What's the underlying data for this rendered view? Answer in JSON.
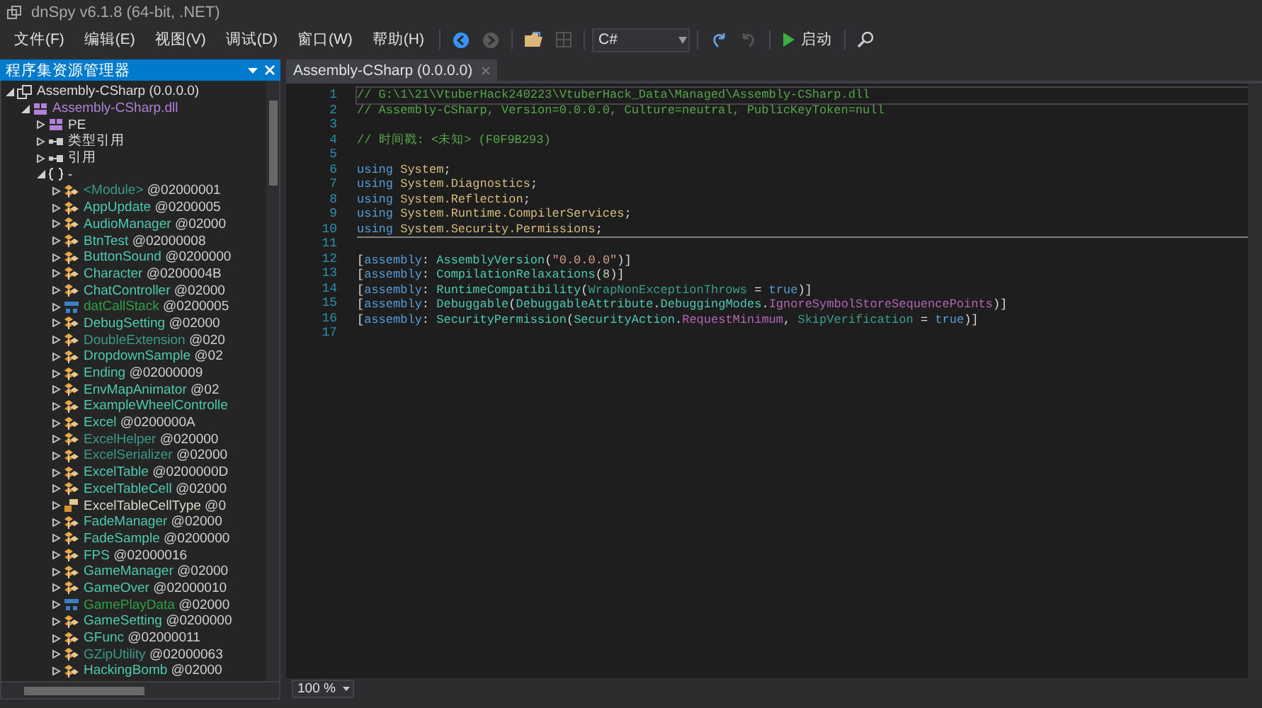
{
  "window": {
    "title": "dnSpy v6.1.8 (64-bit, .NET)"
  },
  "menu": [
    "文件(F)",
    "编辑(E)",
    "视图(V)",
    "调试(D)",
    "窗口(W)",
    "帮助(H)"
  ],
  "toolbar": {
    "language": "C#",
    "start_label": "启动",
    "back_disabled": false,
    "forward_disabled": true,
    "undo_disabled": false,
    "redo_disabled": true
  },
  "explorer": {
    "title": "程序集资源管理器",
    "tree": [
      {
        "label": "Assembly-CSharp (0.0.0.0)",
        "kind": "assembly",
        "expanded": true,
        "children": [
          {
            "label": "Assembly-CSharp.dll",
            "kind": "module",
            "expanded": true,
            "children": [
              {
                "label": "PE",
                "kind": "pe",
                "expanded": false
              },
              {
                "label": "类型引用",
                "kind": "refs",
                "expanded": false
              },
              {
                "label": "引用",
                "kind": "refs",
                "expanded": false
              },
              {
                "label": "-",
                "kind": "namespace",
                "expanded": true,
                "children": [
                  {
                    "label": "<Module>",
                    "token": "@02000001",
                    "kind": "static",
                    "expanded": false
                  },
                  {
                    "label": "AppUpdate",
                    "token": "@0200005",
                    "kind": "class",
                    "expanded": false
                  },
                  {
                    "label": "AudioManager",
                    "token": "@02000",
                    "kind": "class",
                    "expanded": false
                  },
                  {
                    "label": "BtnTest",
                    "token": "@02000008",
                    "kind": "class",
                    "expanded": false
                  },
                  {
                    "label": "ButtonSound",
                    "token": "@0200000",
                    "kind": "class",
                    "expanded": false
                  },
                  {
                    "label": "Character",
                    "token": "@0200004B",
                    "kind": "class",
                    "expanded": false
                  },
                  {
                    "label": "ChatController",
                    "token": "@02000",
                    "kind": "class",
                    "expanded": false
                  },
                  {
                    "label": "datCallStack",
                    "token": "@0200005",
                    "kind": "struct",
                    "expanded": false
                  },
                  {
                    "label": "DebugSetting",
                    "token": "@02000",
                    "kind": "class",
                    "expanded": false
                  },
                  {
                    "label": "DoubleExtension",
                    "token": "@020",
                    "kind": "static",
                    "expanded": false
                  },
                  {
                    "label": "DropdownSample",
                    "token": "@02",
                    "kind": "class",
                    "expanded": false
                  },
                  {
                    "label": "Ending",
                    "token": "@02000009",
                    "kind": "class",
                    "expanded": false
                  },
                  {
                    "label": "EnvMapAnimator",
                    "token": "@02",
                    "kind": "class",
                    "expanded": false
                  },
                  {
                    "label": "ExampleWheelControlle",
                    "kind": "class",
                    "expanded": false
                  },
                  {
                    "label": "Excel",
                    "token": "@0200000A",
                    "kind": "class",
                    "expanded": false
                  },
                  {
                    "label": "ExcelHelper",
                    "token": "@020000",
                    "kind": "static",
                    "expanded": false
                  },
                  {
                    "label": "ExcelSerializer",
                    "token": "@02000",
                    "kind": "static",
                    "expanded": false
                  },
                  {
                    "label": "ExcelTable",
                    "token": "@0200000D",
                    "kind": "class",
                    "expanded": false
                  },
                  {
                    "label": "ExcelTableCell",
                    "token": "@02000",
                    "kind": "class",
                    "expanded": false
                  },
                  {
                    "label": "ExcelTableCellType",
                    "token": "@0",
                    "kind": "enum",
                    "expanded": false
                  },
                  {
                    "label": "FadeManager",
                    "token": "@02000",
                    "kind": "class",
                    "expanded": false
                  },
                  {
                    "label": "FadeSample",
                    "token": "@0200000",
                    "kind": "class",
                    "expanded": false
                  },
                  {
                    "label": "FPS",
                    "token": "@02000016",
                    "kind": "class",
                    "expanded": false
                  },
                  {
                    "label": "GameManager",
                    "token": "@02000",
                    "kind": "class",
                    "expanded": false
                  },
                  {
                    "label": "GameOver",
                    "token": "@02000010",
                    "kind": "class",
                    "expanded": false
                  },
                  {
                    "label": "GamePlayData",
                    "token": "@02000",
                    "kind": "struct",
                    "expanded": false
                  },
                  {
                    "label": "GameSetting",
                    "token": "@0200000",
                    "kind": "class",
                    "expanded": false
                  },
                  {
                    "label": "GFunc",
                    "token": "@02000011",
                    "kind": "class",
                    "expanded": false
                  },
                  {
                    "label": "GZipUtility",
                    "token": "@02000063",
                    "kind": "static",
                    "expanded": false
                  },
                  {
                    "label": "HackingBomb",
                    "token": "@02000",
                    "kind": "class",
                    "expanded": false
                  }
                ]
              }
            ]
          }
        ]
      }
    ]
  },
  "editor": {
    "tab": "Assembly-CSharp (0.0.0.0)",
    "zoom": "100 %",
    "lines": [
      {
        "number": "1",
        "current": true,
        "separator": false,
        "tokens": [
          {
            "kind": "comment",
            "text": "// G:\\1\\21\\VtuberHack240223\\VtuberHack_Data\\Managed\\Assembly-CSharp.dll"
          }
        ]
      },
      {
        "number": "2",
        "current": false,
        "separator": false,
        "tokens": [
          {
            "kind": "comment",
            "text": "// Assembly-CSharp, Version=0.0.0.0, Culture=neutral, PublicKeyToken=null"
          }
        ]
      },
      {
        "number": "3",
        "current": false,
        "separator": false
      },
      {
        "number": "4",
        "current": false,
        "separator": false,
        "tokens": [
          {
            "kind": "comment",
            "text": "// 时间戳: <未知> (F0F9B293)"
          }
        ]
      },
      {
        "number": "5",
        "current": false,
        "separator": false
      },
      {
        "number": "6",
        "current": false,
        "separator": false,
        "tokens": [
          {
            "kind": "keyword",
            "text": "using "
          },
          {
            "kind": "namespace",
            "text": "System"
          },
          {
            "kind": "plain",
            "text": ";"
          }
        ]
      },
      {
        "number": "7",
        "current": false,
        "separator": false,
        "tokens": [
          {
            "kind": "keyword",
            "text": "using "
          },
          {
            "kind": "namespace",
            "text": "System.Diagnostics"
          },
          {
            "kind": "plain",
            "text": ";"
          }
        ]
      },
      {
        "number": "8",
        "current": false,
        "separator": false,
        "tokens": [
          {
            "kind": "keyword",
            "text": "using "
          },
          {
            "kind": "namespace",
            "text": "System.Reflection"
          },
          {
            "kind": "plain",
            "text": ";"
          }
        ]
      },
      {
        "number": "9",
        "current": false,
        "separator": false,
        "tokens": [
          {
            "kind": "keyword",
            "text": "using "
          },
          {
            "kind": "namespace",
            "text": "System.Runtime.CompilerServices"
          },
          {
            "kind": "plain",
            "text": ";"
          }
        ]
      },
      {
        "number": "10",
        "current": false,
        "separator": true,
        "tokens": [
          {
            "kind": "keyword",
            "text": "using "
          },
          {
            "kind": "namespace",
            "text": "System.Security.Permissions"
          },
          {
            "kind": "plain",
            "text": ";"
          }
        ]
      },
      {
        "number": "11",
        "current": false,
        "separator": false
      },
      {
        "number": "12",
        "current": false,
        "separator": false,
        "tokens": [
          {
            "kind": "plain",
            "text": "["
          },
          {
            "kind": "keyword",
            "text": "assembly"
          },
          {
            "kind": "plain",
            "text": ": "
          },
          {
            "kind": "type",
            "text": "AssemblyVersion"
          },
          {
            "kind": "plain",
            "text": "("
          },
          {
            "kind": "string",
            "text": "\"0.0.0.0\""
          },
          {
            "kind": "plain",
            "text": ")]"
          }
        ]
      },
      {
        "number": "13",
        "current": false,
        "separator": false,
        "tokens": [
          {
            "kind": "plain",
            "text": "["
          },
          {
            "kind": "keyword",
            "text": "assembly"
          },
          {
            "kind": "plain",
            "text": ": "
          },
          {
            "kind": "type",
            "text": "CompilationRelaxations"
          },
          {
            "kind": "plain",
            "text": "("
          },
          {
            "kind": "number",
            "text": "8"
          },
          {
            "kind": "plain",
            "text": ")]"
          }
        ]
      },
      {
        "number": "14",
        "current": false,
        "separator": false,
        "tokens": [
          {
            "kind": "plain",
            "text": "["
          },
          {
            "kind": "keyword",
            "text": "assembly"
          },
          {
            "kind": "plain",
            "text": ": "
          },
          {
            "kind": "type",
            "text": "RuntimeCompatibility"
          },
          {
            "kind": "plain",
            "text": "("
          },
          {
            "kind": "property",
            "text": "WrapNonExceptionThrows"
          },
          {
            "kind": "plain",
            "text": " = "
          },
          {
            "kind": "keyword",
            "text": "true"
          },
          {
            "kind": "plain",
            "text": ")]"
          }
        ]
      },
      {
        "number": "15",
        "current": false,
        "separator": false,
        "tokens": [
          {
            "kind": "plain",
            "text": "["
          },
          {
            "kind": "keyword",
            "text": "assembly"
          },
          {
            "kind": "plain",
            "text": ": "
          },
          {
            "kind": "type",
            "text": "Debuggable"
          },
          {
            "kind": "plain",
            "text": "("
          },
          {
            "kind": "type",
            "text": "DebuggableAttribute"
          },
          {
            "kind": "plain",
            "text": "."
          },
          {
            "kind": "type",
            "text": "DebuggingModes"
          },
          {
            "kind": "plain",
            "text": "."
          },
          {
            "kind": "enumvalue",
            "text": "IgnoreSymbolStoreSequencePoints"
          },
          {
            "kind": "plain",
            "text": ")]"
          }
        ]
      },
      {
        "number": "16",
        "current": false,
        "separator": false,
        "tokens": [
          {
            "kind": "plain",
            "text": "["
          },
          {
            "kind": "keyword",
            "text": "assembly"
          },
          {
            "kind": "plain",
            "text": ": "
          },
          {
            "kind": "type",
            "text": "SecurityPermission"
          },
          {
            "kind": "plain",
            "text": "("
          },
          {
            "kind": "type",
            "text": "SecurityAction"
          },
          {
            "kind": "plain",
            "text": "."
          },
          {
            "kind": "enumvalue",
            "text": "RequestMinimum"
          },
          {
            "kind": "plain",
            "text": ", "
          },
          {
            "kind": "property",
            "text": "SkipVerification"
          },
          {
            "kind": "plain",
            "text": " = "
          },
          {
            "kind": "keyword",
            "text": "true"
          },
          {
            "kind": "plain",
            "text": ")]"
          }
        ]
      },
      {
        "number": "17",
        "current": false,
        "separator": false
      }
    ]
  }
}
